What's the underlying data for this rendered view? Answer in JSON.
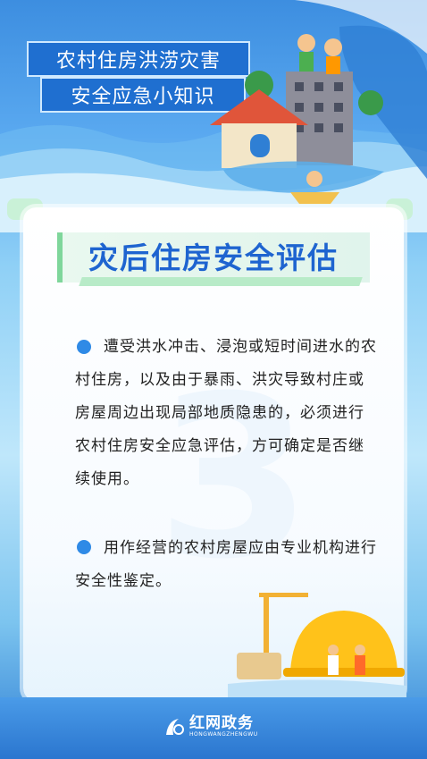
{
  "header": {
    "title_line1": "农村住房洪涝灾害",
    "title_line2": "安全应急小知识"
  },
  "card": {
    "section_number": "3",
    "heading": "灾后住房安全评估",
    "paragraphs": [
      "遭受洪水冲击、浸泡或短时间进水的农村住房，以及由于暴雨、洪灾导致村庄或房屋周边出现局部地质隐患的，必须进行农村住房安全应急评估，方可确定是否继续使用。",
      "用作经营的农村房屋应由专业机构进行安全性鉴定。"
    ]
  },
  "footer": {
    "logo_cn": "红网政务",
    "logo_en": "HONGWANGZHENGWU"
  },
  "colors": {
    "primary_blue": "#1e64d0",
    "bullet_blue": "#2f8ae6",
    "accent_green": "#7fd69b"
  }
}
